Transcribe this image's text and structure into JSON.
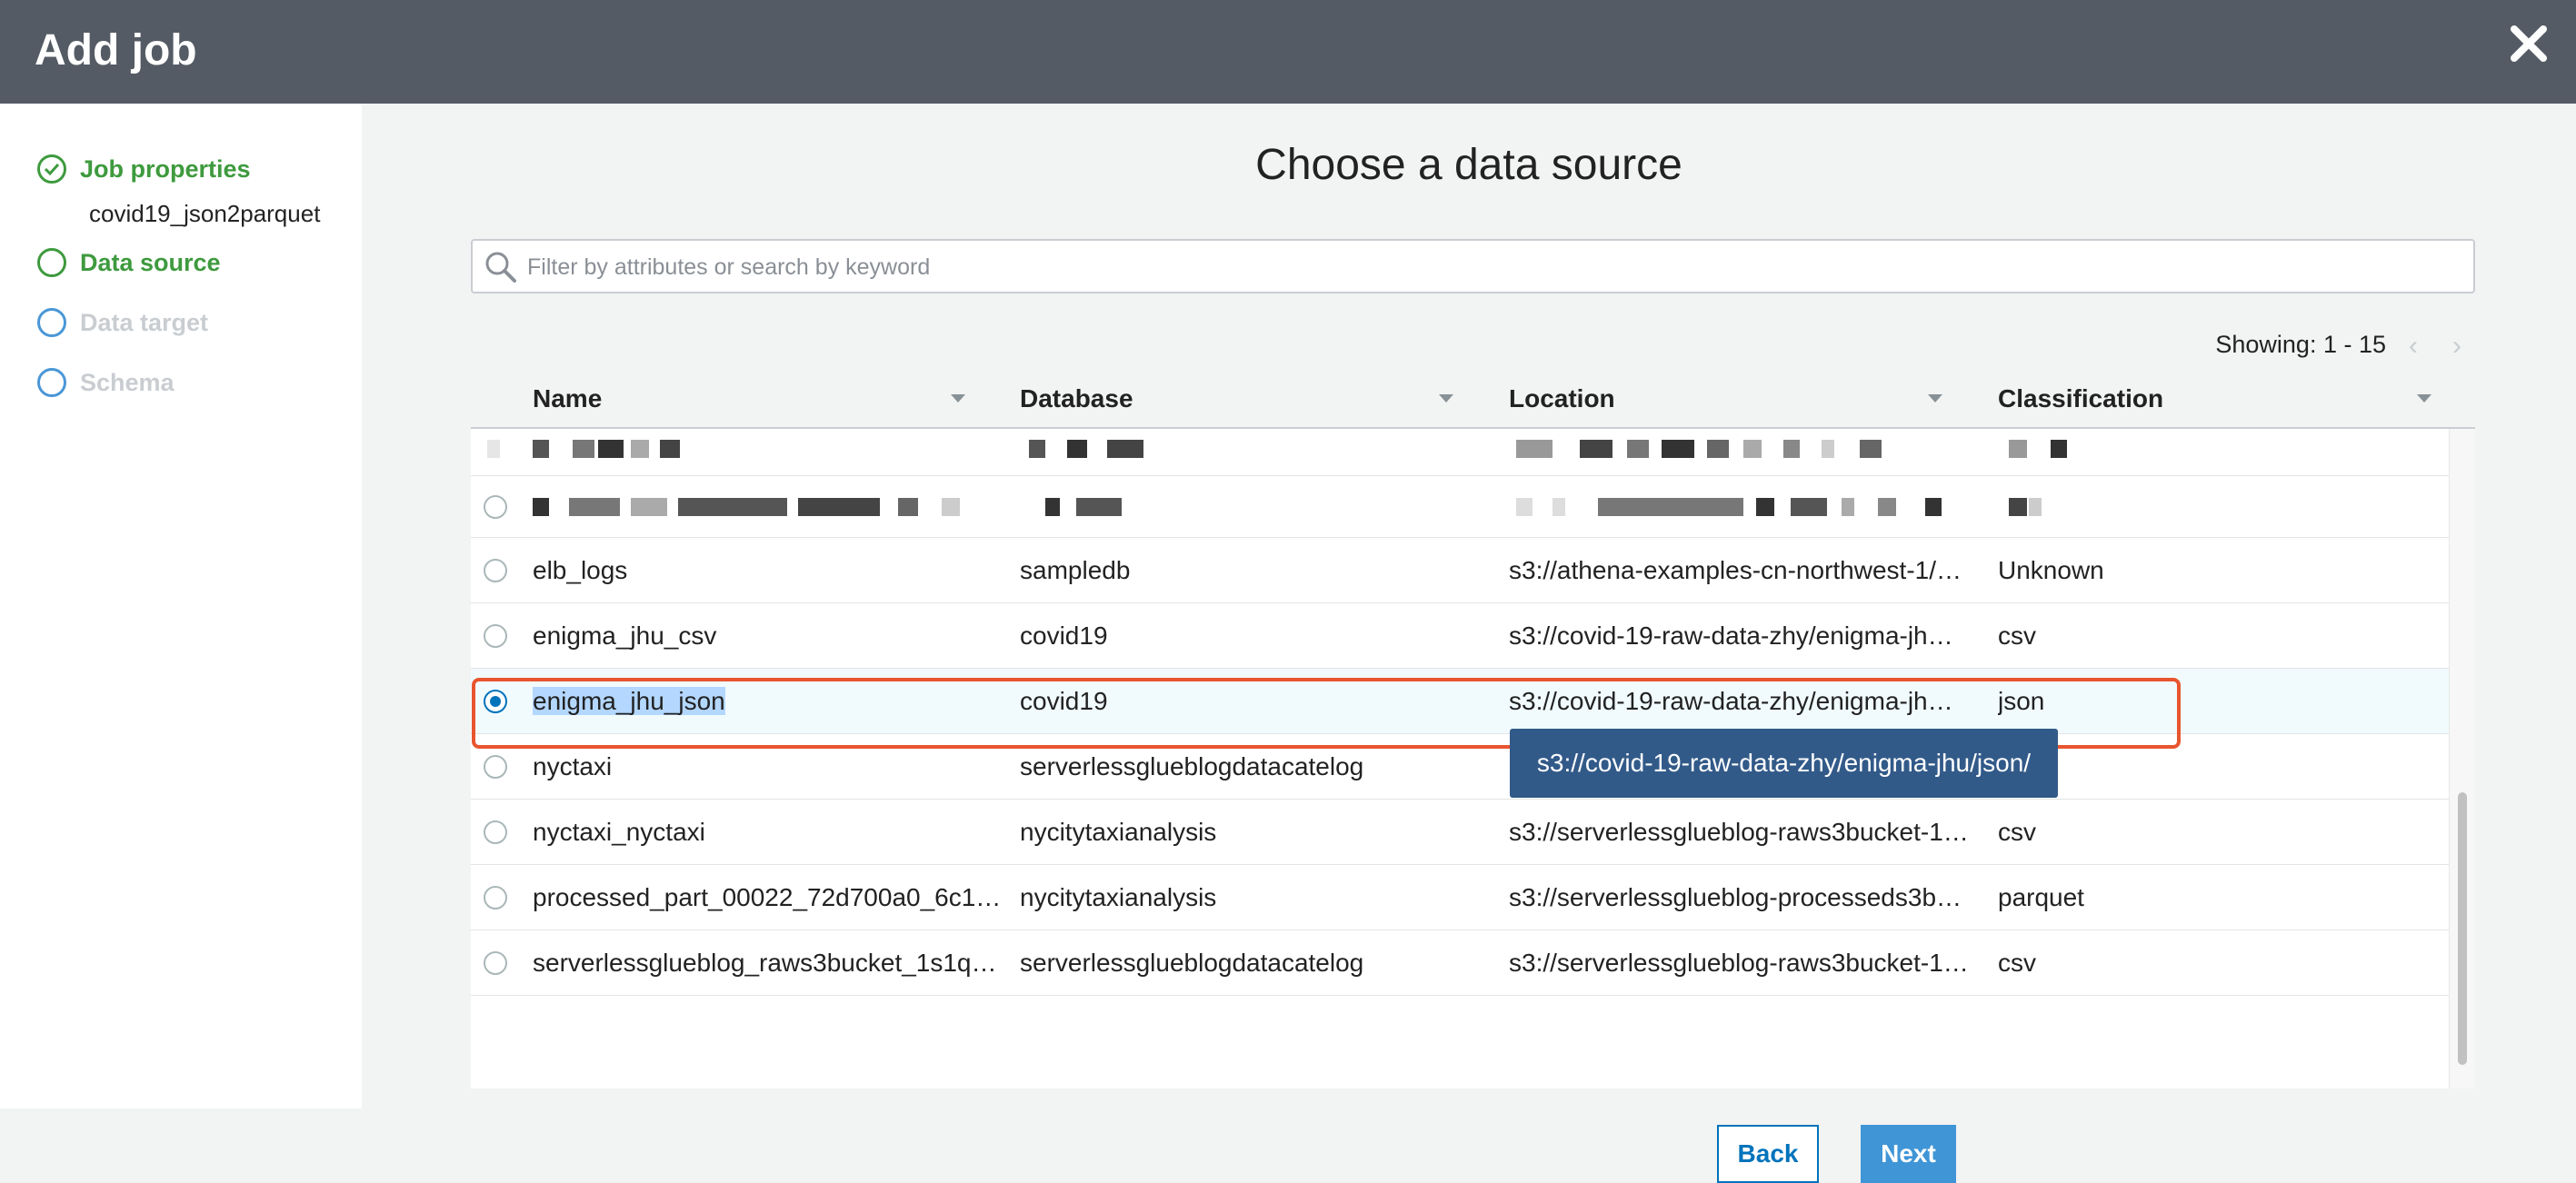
{
  "dialog": {
    "title": "Add job"
  },
  "sidebar": {
    "steps": [
      {
        "label": "Job properties",
        "state": "done",
        "sub": "covid19_json2parquet"
      },
      {
        "label": "Data source",
        "state": "current"
      },
      {
        "label": "Data target",
        "state": "pending"
      },
      {
        "label": "Schema",
        "state": "pending"
      }
    ]
  },
  "main": {
    "title": "Choose a data source",
    "search_placeholder": "Filter by attributes or search by keyword",
    "showing": "Showing: 1 - 15"
  },
  "table": {
    "columns": [
      "Name",
      "Database",
      "Location",
      "Classification"
    ],
    "rows": [
      {
        "name": "elb_logs",
        "database": "sampledb",
        "location": "s3://athena-examples-cn-northwest-1/…",
        "classification": "Unknown",
        "selected": false
      },
      {
        "name": "enigma_jhu_csv",
        "database": "covid19",
        "location": "s3://covid-19-raw-data-zhy/enigma-jh…",
        "classification": "csv",
        "selected": false
      },
      {
        "name": "enigma_jhu_json",
        "database": "covid19",
        "location": "s3://covid-19-raw-data-zhy/enigma-jh…",
        "classification": "json",
        "selected": true
      },
      {
        "name": "nyctaxi",
        "database": "serverlessglueblogdatacatelog",
        "location": "",
        "classification": "",
        "selected": false
      },
      {
        "name": "nyctaxi_nyctaxi",
        "database": "nycitytaxianalysis",
        "location": "s3://serverlessglueblog-raws3bucket-1…",
        "classification": "csv",
        "selected": false
      },
      {
        "name": "processed_part_00022_72d700a0_6c1…",
        "database": "nycitytaxianalysis",
        "location": "s3://serverlessglueblog-processeds3b…",
        "classification": "parquet",
        "selected": false
      },
      {
        "name": "serverlessglueblog_raws3bucket_1s1q…",
        "database": "serverlessglueblogdatacatelog",
        "location": "s3://serverlessglueblog-raws3bucket-1…",
        "classification": "csv",
        "selected": false
      }
    ]
  },
  "tooltip": {
    "text": "s3://covid-19-raw-data-zhy/enigma-jhu/json/"
  },
  "footer": {
    "back": "Back",
    "next": "Next"
  },
  "colors": {
    "header_bg": "#545b64",
    "step_active": "#3e9a3e",
    "step_pending": "#c9cdd1",
    "accent_blue": "#0073bb",
    "highlight_border": "#e8552f",
    "tooltip_bg": "#325a89"
  }
}
